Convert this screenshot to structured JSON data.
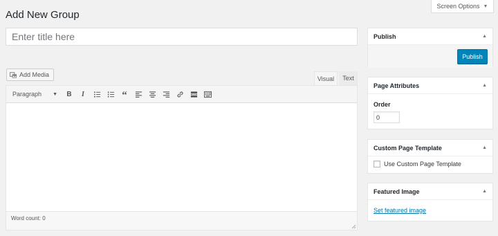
{
  "screen_options": {
    "label": "Screen Options"
  },
  "page": {
    "title": "Add New Group"
  },
  "title_field": {
    "placeholder": "Enter title here",
    "value": ""
  },
  "editor": {
    "add_media_label": "Add Media",
    "tabs": [
      {
        "label": "Visual",
        "active": true
      },
      {
        "label": "Text",
        "active": false
      }
    ],
    "format_select": "Paragraph",
    "toolbar_buttons": [
      {
        "icon": "bold-icon",
        "glyph": "B"
      },
      {
        "icon": "italic-icon",
        "glyph": "I"
      },
      {
        "icon": "bulleted-list-icon"
      },
      {
        "icon": "numbered-list-icon"
      },
      {
        "icon": "blockquote-icon",
        "glyph": "“"
      },
      {
        "icon": "align-left-icon"
      },
      {
        "icon": "align-center-icon"
      },
      {
        "icon": "align-right-icon"
      },
      {
        "icon": "link-icon"
      },
      {
        "icon": "read-more-icon"
      },
      {
        "icon": "toolbar-toggle-icon"
      }
    ],
    "word_count": "Word count: 0"
  },
  "sidebar": {
    "publish": {
      "title": "Publish",
      "button_label": "Publish"
    },
    "page_attributes": {
      "title": "Page Attributes",
      "order_label": "Order",
      "order_value": "0"
    },
    "custom_template": {
      "title": "Custom Page Template",
      "checkbox_label": "Use Custom Page Template",
      "checked": false
    },
    "featured_image": {
      "title": "Featured Image",
      "link_label": "Set featured image"
    }
  },
  "colors": {
    "primary_button": "#0085ba",
    "link": "#0073aa",
    "background": "#f1f1f1"
  }
}
